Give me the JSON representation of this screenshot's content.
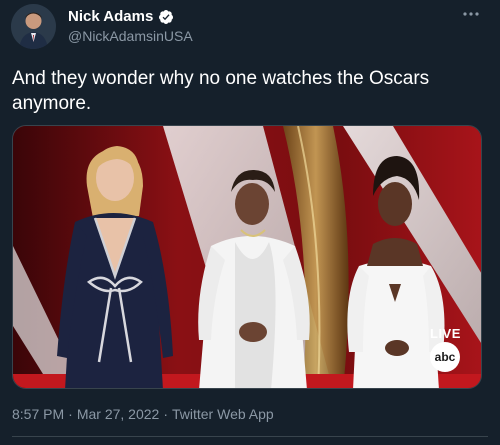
{
  "author": {
    "display_name": "Nick Adams",
    "handle": "@NickAdamsinUSA",
    "verified": true,
    "avatar_icon": "avatar-photo"
  },
  "tweet": {
    "text": "And they wonder why no one watches the Oscars anymore."
  },
  "media": {
    "overlay_live": "LIVE",
    "overlay_network": "abc"
  },
  "meta": {
    "time": "8:57 PM",
    "date": "Mar 27, 2022",
    "separator": "·",
    "source": "Twitter Web App"
  },
  "colors": {
    "background": "#15202b",
    "secondary_text": "#8b98a5",
    "verified": "#ffffff",
    "border": "#38444d"
  },
  "icons": {
    "more": "more-horizontal-icon",
    "verified": "verified-badge-icon"
  }
}
